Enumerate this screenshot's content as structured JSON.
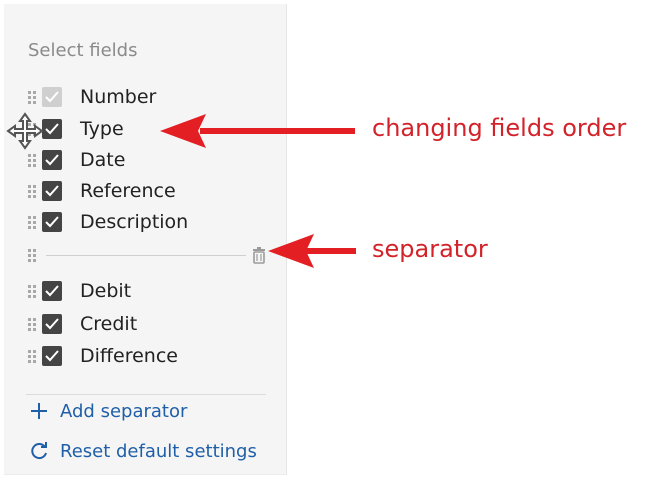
{
  "panel": {
    "title": "Select fields",
    "fields": [
      {
        "label": "Number",
        "checked": true,
        "disabled": true
      },
      {
        "label": "Type",
        "checked": true,
        "disabled": false
      },
      {
        "label": "Date",
        "checked": true,
        "disabled": false
      },
      {
        "label": "Reference",
        "checked": true,
        "disabled": false
      },
      {
        "label": "Description",
        "checked": true,
        "disabled": false
      }
    ],
    "fields_after_separator": [
      {
        "label": "Debit",
        "checked": true,
        "disabled": false
      },
      {
        "label": "Credit",
        "checked": true,
        "disabled": false
      },
      {
        "label": "Difference",
        "checked": true,
        "disabled": false
      }
    ],
    "add_separator_label": "Add separator",
    "reset_label": "Reset default settings"
  },
  "annotations": {
    "order": "changing fields order",
    "separator": "separator"
  },
  "colors": {
    "accent": "#1f5fa8",
    "annotation": "#d2232a",
    "checkbox": "#444444",
    "checkbox_disabled": "#cfcfcf"
  },
  "icons": {
    "drag_handle": "drag-handle-icon",
    "checkbox": "checkmark-icon",
    "trash": "trash-icon",
    "add": "plus-icon",
    "reset": "reset-icon",
    "move_cursor": "move-cursor-icon"
  }
}
